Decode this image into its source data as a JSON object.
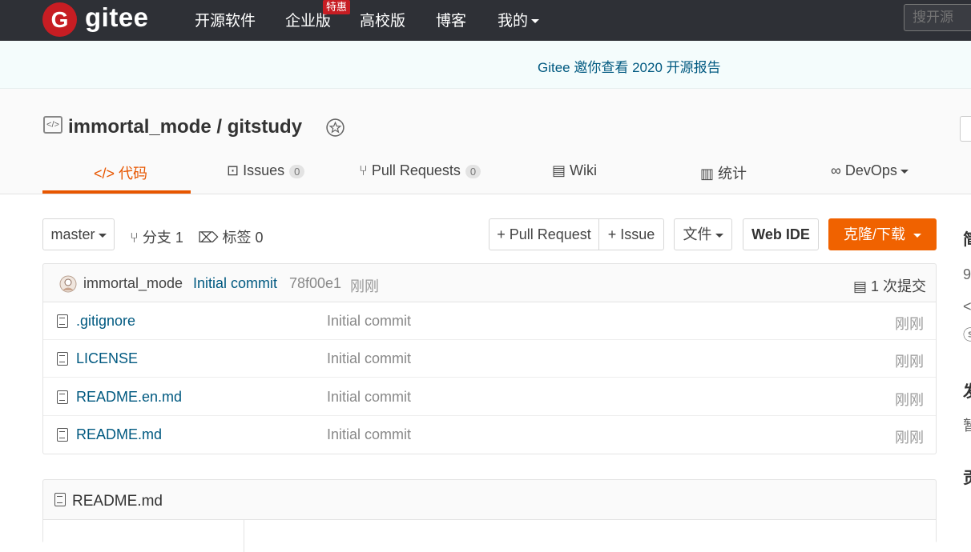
{
  "nav": {
    "logo_glyph": "G",
    "logo_text": "gitee",
    "links": [
      "开源软件",
      "企业版",
      "高校版",
      "博客",
      "我的"
    ],
    "badge": "特惠",
    "search_placeholder": "搜开源"
  },
  "announcement": "Gitee 邀你查看 2020 开源报告",
  "repo": {
    "title": "immortal_mode / gitstudy",
    "tabs": {
      "code": "代码",
      "issues": "Issues",
      "issues_count": "0",
      "pulls": "Pull Requests",
      "pulls_count": "0",
      "wiki": "Wiki",
      "stats": "统计",
      "devops": "DevOps"
    }
  },
  "toolbar": {
    "branch": "master",
    "branches": "分支 1",
    "tags": "标签 0",
    "pull_request": "+ Pull Request",
    "issue": "+ Issue",
    "file": "文件",
    "web_ide": "Web IDE",
    "clone": "克隆/下载"
  },
  "commit": {
    "author": "immortal_mode",
    "message": "Initial commit",
    "hash": "78f00e1",
    "time": "刚刚",
    "count": "1 次提交"
  },
  "files": [
    {
      "name": ".gitignore",
      "message": "Initial commit",
      "time": "刚刚"
    },
    {
      "name": "LICENSE",
      "message": "Initial commit",
      "time": "刚刚"
    },
    {
      "name": "README.en.md",
      "message": "Initial commit",
      "time": "刚刚"
    },
    {
      "name": "README.md",
      "message": "Initial commit",
      "time": "刚刚"
    }
  ],
  "readme_title": "README.md",
  "sidebar_cut": [
    "简",
    "9",
    "</",
    "ⓢ",
    "发",
    "暂",
    "贡"
  ],
  "colors": {
    "brand_red": "#c71d23",
    "accent_orange": "#f06200",
    "link_blue": "#005980",
    "nav_bg": "#2e3036"
  }
}
